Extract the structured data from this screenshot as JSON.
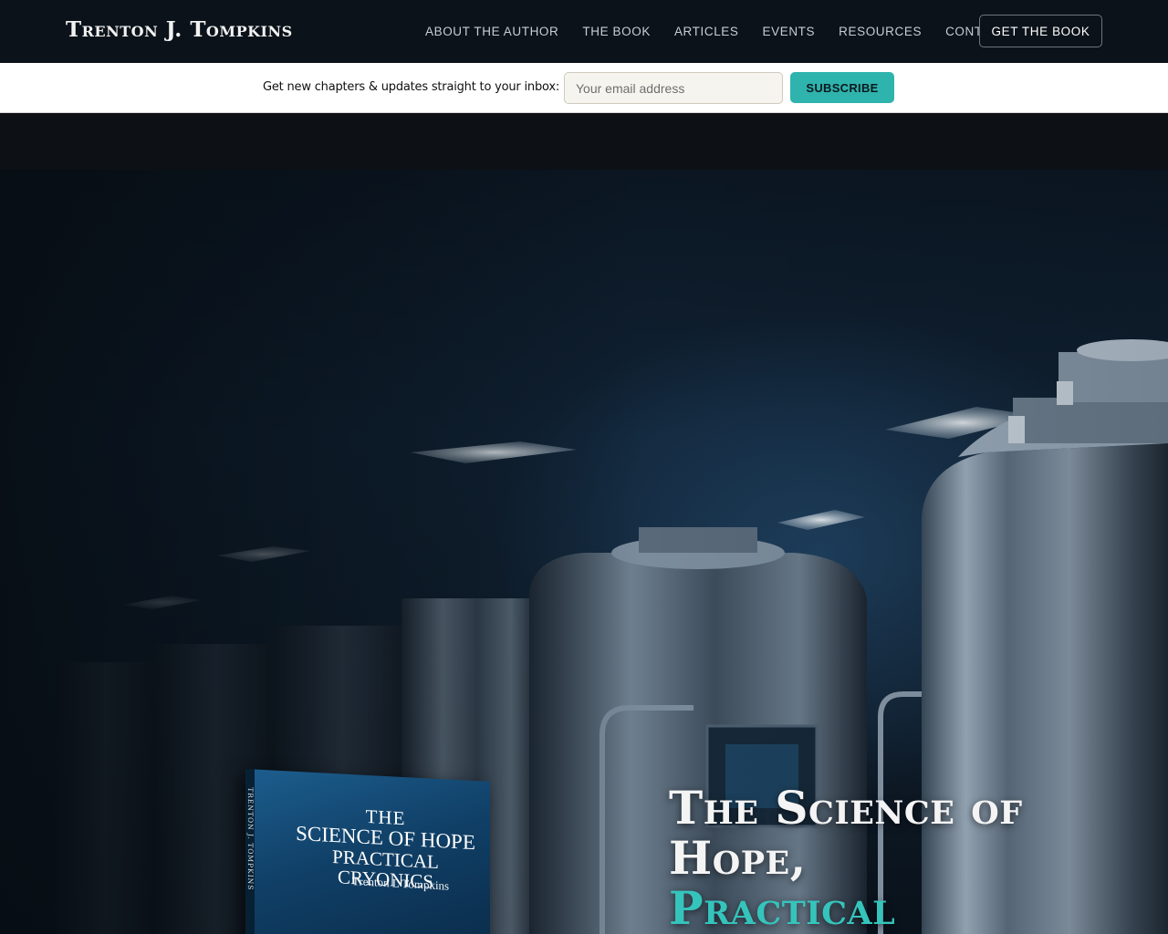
{
  "nav": {
    "brand": "Trenton J. Tompkins",
    "links": [
      "About the Author",
      "The Book",
      "Articles",
      "Events",
      "Resources",
      "Contact"
    ],
    "cta": "Get the Book"
  },
  "subscribe": {
    "label": "Get new chapters & updates straight to your inbox:",
    "placeholder": "Your email address",
    "button": "Subscribe"
  },
  "hero": {
    "book": {
      "title_line1": "THE",
      "title_line2": "SCIENCE OF HOPE",
      "title_line3": "PRACTICAL CRYONICS",
      "author": "Trenton L Tompkins",
      "spine": "TRENTON J. TOMPKINS"
    },
    "headline": "The Science of Hope,",
    "headline_accent": "Practical"
  },
  "colors": {
    "nav_bg": "#0b1219",
    "accent": "#35c4bc",
    "subscribe_button": "#2fb3ad"
  }
}
